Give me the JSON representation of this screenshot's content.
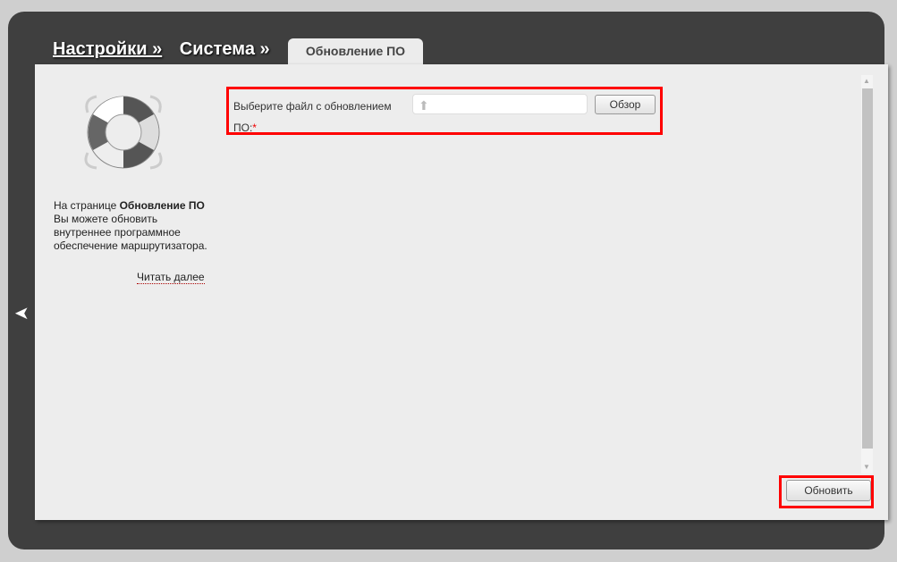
{
  "breadcrumb": {
    "items": [
      "Настройки »",
      "Система »"
    ]
  },
  "tab": {
    "label": "Обновление ПО"
  },
  "sidebar": {
    "desc_prefix": "На странице ",
    "desc_bold": "Обновление ПО",
    "desc_rest": " Вы можете обновить внутреннее программное обеспечение маршрутизатора.",
    "read_more": "Читать далее"
  },
  "form": {
    "file_label": "Выберите файл с обновлением ПО:",
    "required_mark": "*",
    "file_value": "",
    "browse_label": "Обзор"
  },
  "actions": {
    "update_label": "Обновить"
  }
}
